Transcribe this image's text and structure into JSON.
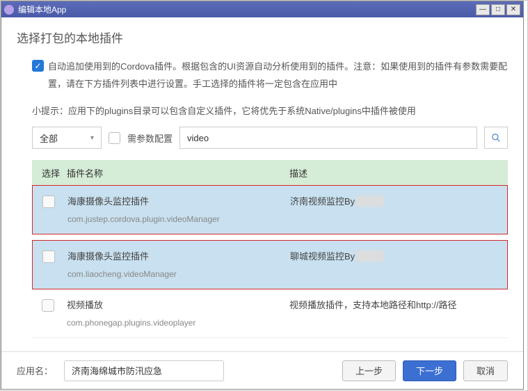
{
  "window": {
    "title": "编辑本地App"
  },
  "header": {
    "title": "选择打包的本地插件"
  },
  "auto_add": {
    "description": "自动追加使用到的Cordova插件。根据包含的UI资源自动分析使用到的插件。注意：如果使用到的插件有参数需要配置，请在下方插件列表中进行设置。手工选择的插件将一定包含在应用中"
  },
  "hint": "小提示：应用下的plugins目录可以包含自定义插件，它将优先于系统Native/plugins中插件被使用",
  "filter": {
    "select_value": "全部",
    "param_label": "需参数配置",
    "search_value": "video"
  },
  "table": {
    "head": {
      "select": "选择",
      "name": "插件名称",
      "desc": "描述"
    },
    "rows": [
      {
        "name": "海康摄像头监控插件",
        "id": "com.justep.cordova.plugin.videoManager",
        "desc": "济南视频监控By"
      },
      {
        "name": "海康摄像头监控插件",
        "id": "com.liaocheng.videoManager",
        "desc": "聊城视频监控By"
      },
      {
        "name": "视频播放",
        "id": "com.phonegap.plugins.videoplayer",
        "desc": "视频播放插件，支持本地路径和http://路径"
      }
    ]
  },
  "footer": {
    "app_label": "应用名：",
    "app_name": "济南海绵城市防汛应急",
    "prev": "上一步",
    "next": "下一步",
    "cancel": "取消"
  }
}
